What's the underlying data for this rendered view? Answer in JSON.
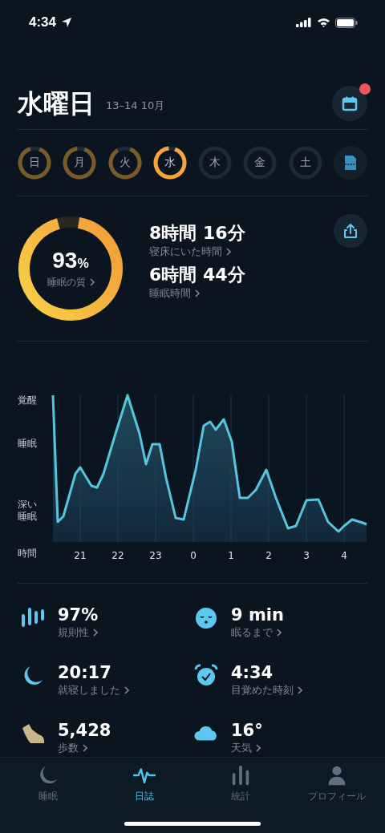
{
  "status_bar": {
    "time": "4:34"
  },
  "header": {
    "title": "水曜日",
    "date_range": "13–14 10月",
    "notification_dot": true
  },
  "days": [
    {
      "label": "日",
      "level": 0.9,
      "selected": false
    },
    {
      "label": "月",
      "level": 0.92,
      "selected": false
    },
    {
      "label": "火",
      "level": 0.86,
      "selected": false
    },
    {
      "label": "水",
      "level": 0.93,
      "selected": true
    },
    {
      "label": "木",
      "level": 0,
      "selected": false
    },
    {
      "label": "金",
      "level": 0,
      "selected": false
    },
    {
      "label": "土",
      "level": 0,
      "selected": false
    }
  ],
  "summary": {
    "quality": {
      "value": "93",
      "unit": "%",
      "label": "睡眠の質",
      "level": 0.93
    },
    "metrics": [
      {
        "value": "8時間 16分",
        "label": "寝床にいた時間"
      },
      {
        "value": "6時間 44分",
        "label": "睡眠時間"
      }
    ]
  },
  "chart": {
    "y_labels": [
      "覚醒",
      "睡眠",
      "深い睡眠"
    ],
    "x_title": "時間",
    "x_labels": [
      "21",
      "22",
      "23",
      "0",
      "1",
      "2",
      "3",
      "4"
    ]
  },
  "stats": [
    {
      "kind": "bars",
      "value": "97%",
      "label": "規則性"
    },
    {
      "kind": "sleepy",
      "value": "9 min",
      "label": "眠るまで"
    },
    {
      "kind": "moon",
      "value": "20:17",
      "label": "就寝しました"
    },
    {
      "kind": "alarm",
      "value": "4:34",
      "label": "目覚めた時刻"
    },
    {
      "kind": "shoe",
      "value": "5,428",
      "label": "歩数"
    },
    {
      "kind": "cloud",
      "value": "16°",
      "label": "天気"
    }
  ],
  "tabs": [
    {
      "kind": "moon",
      "label": "睡眠",
      "selected": false
    },
    {
      "kind": "wave",
      "label": "日誌",
      "selected": true
    },
    {
      "kind": "bars",
      "label": "統計",
      "selected": false
    },
    {
      "kind": "person",
      "label": "プロフィール",
      "selected": false
    }
  ]
}
